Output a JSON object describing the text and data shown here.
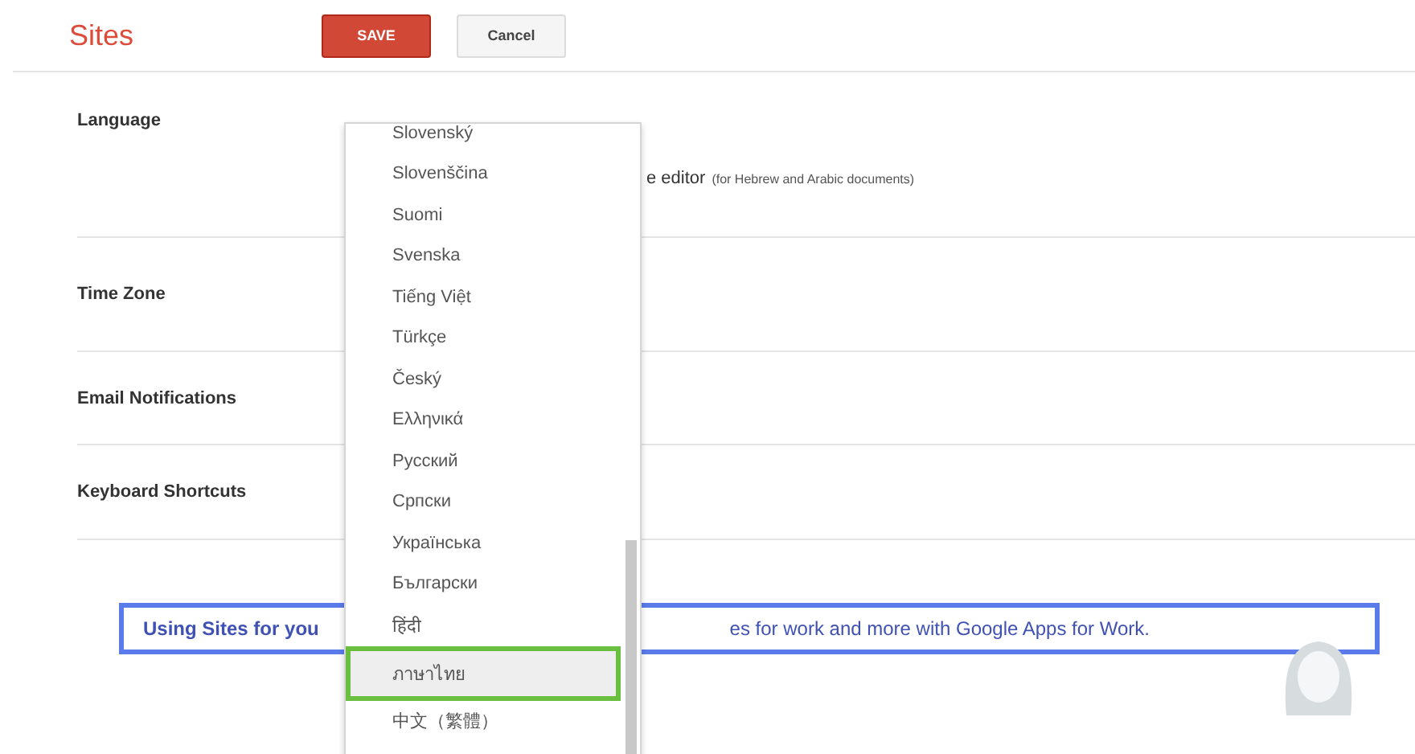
{
  "header": {
    "title": "Sites",
    "buttons": [
      {
        "kind": "primary",
        "label": "SAVE"
      },
      {
        "kind": "secondary",
        "label": "Cancel"
      }
    ]
  },
  "settings": [
    {
      "label": "Language",
      "text": "e editor",
      "note": "(for Hebrew and Arabic documents)"
    },
    {
      "label": "Time Zone"
    },
    {
      "label": "Email Notifications"
    },
    {
      "label": "Keyboard Shortcuts"
    }
  ],
  "banner": {
    "lead": "Using Sites for you",
    "rest": "es for work and more with Google Apps for Work."
  },
  "language_menu": {
    "items": [
      {
        "label": "Slovenský",
        "selected": false
      },
      {
        "label": "Slovenščina",
        "selected": false
      },
      {
        "label": "Suomi",
        "selected": false
      },
      {
        "label": "Svenska",
        "selected": false
      },
      {
        "label": "Tiếng Việt",
        "selected": false
      },
      {
        "label": "Türkçe",
        "selected": false
      },
      {
        "label": "Český",
        "selected": false
      },
      {
        "label": "Ελληνικά",
        "selected": false
      },
      {
        "label": "Русский",
        "selected": false
      },
      {
        "label": "Српски",
        "selected": false
      },
      {
        "label": "Українська",
        "selected": false
      },
      {
        "label": "Български",
        "selected": false
      },
      {
        "label": "हिंदी",
        "selected": false
      },
      {
        "label": "ภาษาไทย",
        "selected": true
      },
      {
        "label": "中文（繁體）",
        "selected": false
      }
    ]
  }
}
